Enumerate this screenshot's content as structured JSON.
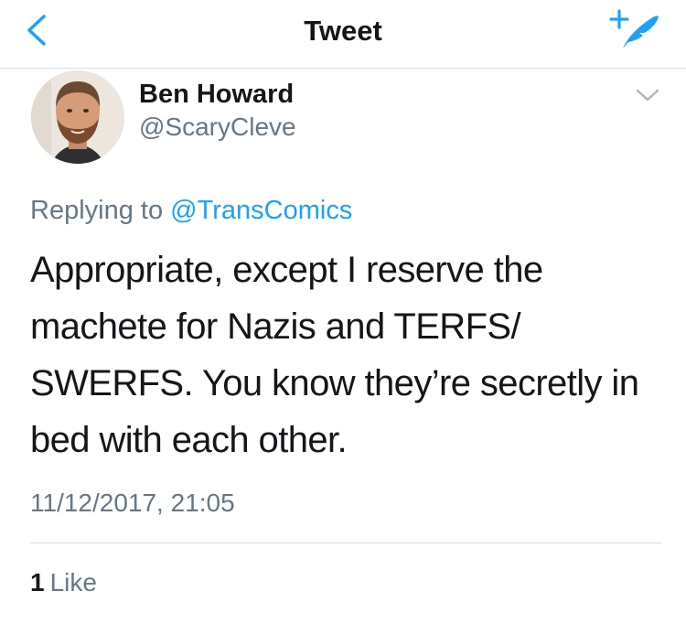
{
  "nav": {
    "title": "Tweet"
  },
  "tweet": {
    "author_name": "Ben Howard",
    "author_handle": "@ScaryCleve",
    "replying_prefix": "Replying to",
    "replying_to": "@TransComics",
    "text": "Appropriate, except I reserve the\nmachete for Nazis and TERFS/\nSWERFS. You know they’re secretly in\nbed with each other.",
    "timestamp": "11/12/2017, 21:05",
    "like_count": "1",
    "like_label": "Like"
  },
  "colors": {
    "accent": "#1da1f2",
    "text_primary": "#14171a",
    "text_secondary": "#657786",
    "divider": "#d8dde2"
  },
  "icons": {
    "back": "chevron-left-icon",
    "compose": "compose-tweet-icon",
    "more": "chevron-down-icon"
  }
}
